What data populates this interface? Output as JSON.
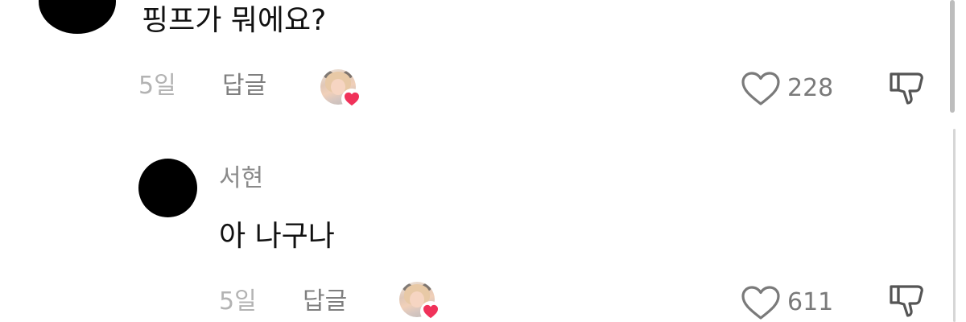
{
  "comments": [
    {
      "text": "핑프가 뭐에요?",
      "time": "5일",
      "reply_label": "답글",
      "likes": "228"
    },
    {
      "username": "서현",
      "text": "아 나구나",
      "time": "5일",
      "reply_label": "답글",
      "likes": "611"
    }
  ],
  "icons": {
    "like": "heart-outline-icon",
    "dislike": "thumbs-down-outline-icon",
    "creator_like": "creator-liked-heart-icon"
  },
  "colors": {
    "text_primary": "#111111",
    "text_secondary": "#7a7a7a",
    "heart": "#f0325a"
  }
}
